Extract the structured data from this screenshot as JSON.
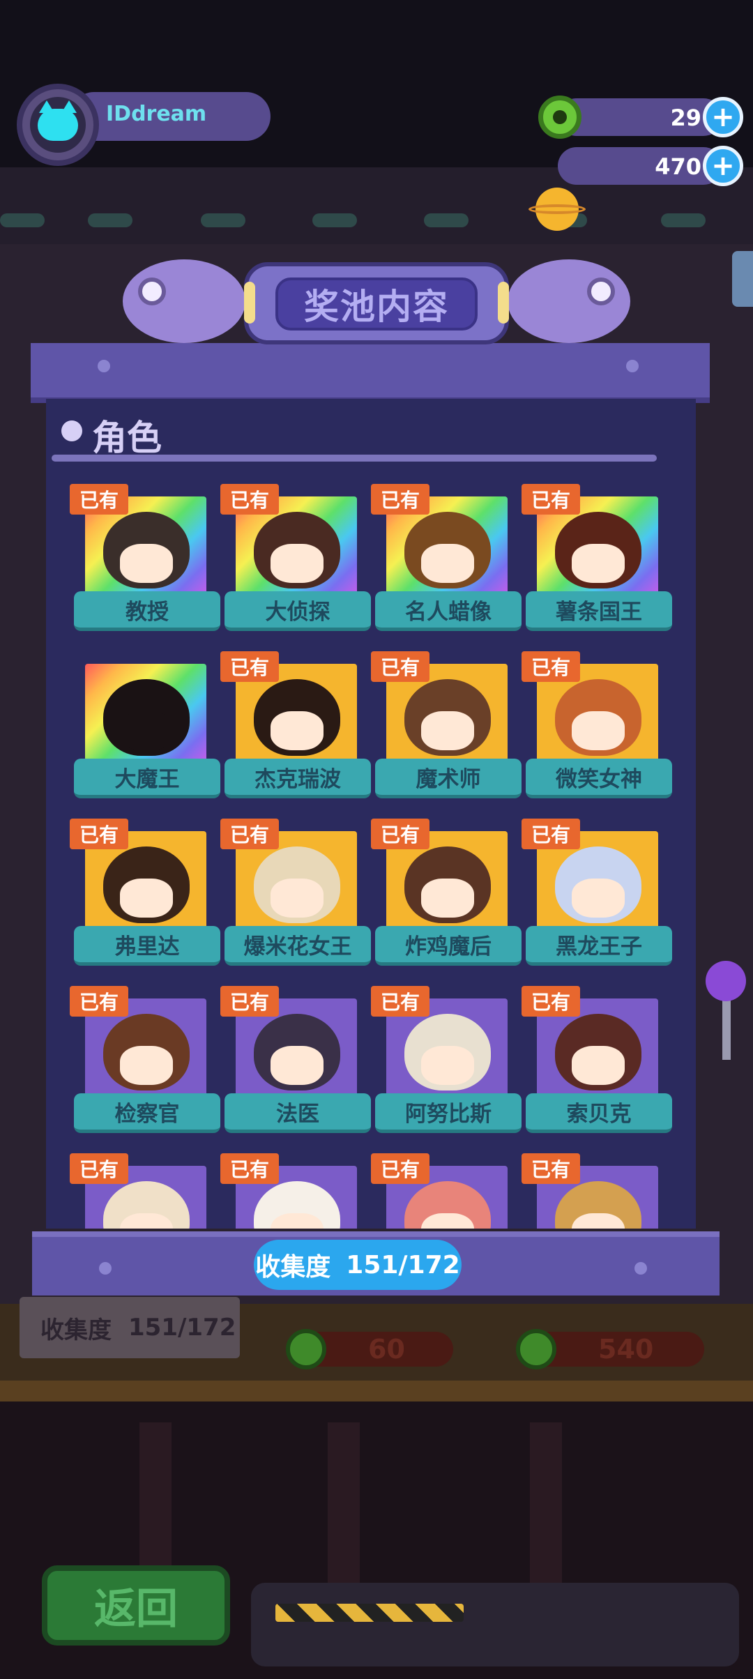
{
  "player": {
    "name": "IDdream",
    "avatar_icon": "cat-avatar-icon"
  },
  "resources": [
    {
      "icon": "green-donut-coin-icon",
      "value": "29"
    },
    {
      "icon": "orange-planet-coin-icon",
      "value": "470"
    }
  ],
  "panel": {
    "title": "奖池内容",
    "section_title": "角色",
    "owned_badge": "已有",
    "collection_label": "收集度",
    "collection_value": "151/172",
    "characters": [
      {
        "name": "教授",
        "owned": true,
        "rarity_bg": "rainbow"
      },
      {
        "name": "大侦探",
        "owned": true,
        "rarity_bg": "rainbow"
      },
      {
        "name": "名人蜡像",
        "owned": true,
        "rarity_bg": "rainbow"
      },
      {
        "name": "薯条国王",
        "owned": true,
        "rarity_bg": "rainbow"
      },
      {
        "name": "大魔王",
        "owned": false,
        "rarity_bg": "rainbow"
      },
      {
        "name": "杰克瑞波",
        "owned": true,
        "rarity_bg": "gold"
      },
      {
        "name": "魔术师",
        "owned": true,
        "rarity_bg": "gold"
      },
      {
        "name": "微笑女神",
        "owned": true,
        "rarity_bg": "gold"
      },
      {
        "name": "弗里达",
        "owned": true,
        "rarity_bg": "gold"
      },
      {
        "name": "爆米花女王",
        "owned": true,
        "rarity_bg": "gold"
      },
      {
        "name": "炸鸡魔后",
        "owned": true,
        "rarity_bg": "gold"
      },
      {
        "name": "黑龙王子",
        "owned": true,
        "rarity_bg": "gold"
      },
      {
        "name": "检察官",
        "owned": true,
        "rarity_bg": "purple"
      },
      {
        "name": "法医",
        "owned": true,
        "rarity_bg": "purple"
      },
      {
        "name": "阿努比斯",
        "owned": true,
        "rarity_bg": "purple"
      },
      {
        "name": "索贝克",
        "owned": true,
        "rarity_bg": "purple"
      },
      {
        "name": "",
        "owned": true,
        "rarity_bg": "purple"
      },
      {
        "name": "",
        "owned": true,
        "rarity_bg": "purple"
      },
      {
        "name": "",
        "owned": true,
        "rarity_bg": "purple"
      },
      {
        "name": "",
        "owned": true,
        "rarity_bg": "purple"
      }
    ]
  },
  "background": {
    "collection_label": "收集度",
    "collection_value": "151/172",
    "prices": [
      "60",
      "540"
    ],
    "back_button": "返回"
  },
  "colors": {
    "panel": "#2b2a5e",
    "panel_frame": "#5f55a8",
    "owned_badge": "#e8672e",
    "name_tag": "#3aa8b0",
    "collection_pill": "#2ba7ee",
    "rainbow": "#ff5a5a",
    "gold": "#f5b52e",
    "purple": "#7b5cc8"
  }
}
